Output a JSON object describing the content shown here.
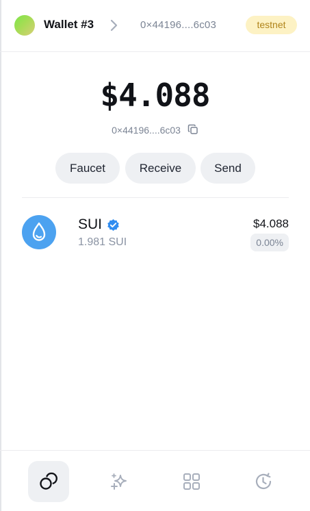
{
  "header": {
    "wallet_name": "Wallet #3",
    "address": "0×44196....6c03",
    "network_badge": "testnet"
  },
  "balance": {
    "total": "$4.088",
    "address": "0×44196....6c03"
  },
  "actions": {
    "faucet_label": "Faucet",
    "receive_label": "Receive",
    "send_label": "Send"
  },
  "tokens": [
    {
      "symbol": "SUI",
      "amount": "1.981 SUI",
      "value": "$4.088",
      "change": "0.00%",
      "verified": true,
      "icon": "sui-drop-icon",
      "color": "#4ca2f0"
    }
  ],
  "nav": {
    "items": [
      {
        "icon": "coins-icon",
        "active": true
      },
      {
        "icon": "sparkles-icon",
        "active": false
      },
      {
        "icon": "apps-grid-icon",
        "active": false
      },
      {
        "icon": "history-icon",
        "active": false
      }
    ]
  },
  "colors": {
    "accent_blue": "#4ca2f0",
    "badge_bg": "#fdf2c4",
    "badge_text": "#b0841a",
    "pill_bg": "#eef0f3"
  }
}
